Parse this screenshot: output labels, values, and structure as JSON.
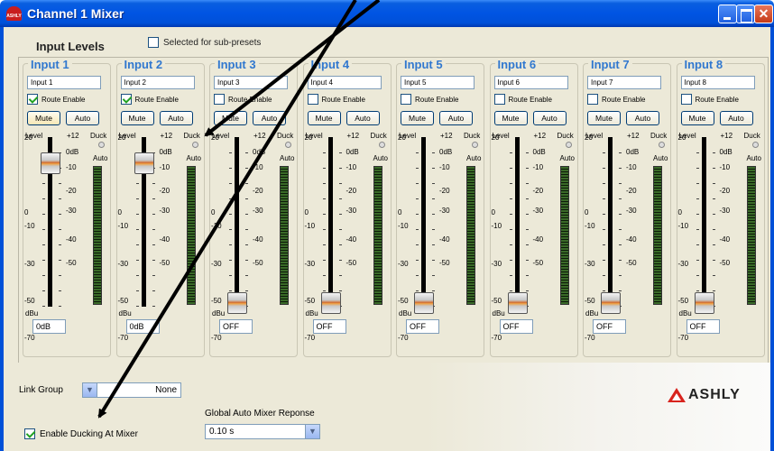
{
  "window": {
    "title": "Channel 1   Mixer",
    "app_icon_text": "ASHLY",
    "buttons": [
      "minimize-icon",
      "maximize-icon",
      "close-icon"
    ]
  },
  "header": {
    "input_levels_label": "Input Levels",
    "selected_sub_presets_label": "Selected for sub-presets",
    "selected_sub_presets_checked": false
  },
  "strip_labels": {
    "route_enable": "Route Enable",
    "mute": "Mute",
    "auto": "Auto",
    "level": "Level",
    "plus12": "+12",
    "duck": "Duck",
    "auto_meter": "Auto",
    "dbu": "dBu",
    "left_scale": [
      "20",
      "0",
      "-10",
      "-30",
      "-50",
      "-70"
    ],
    "right_scale": [
      "0dB",
      "-10",
      "-20",
      "-30",
      "-40",
      "-50"
    ]
  },
  "channels": [
    {
      "title": "Input 1",
      "name": "Input 1",
      "route_enable": true,
      "fader_value": "0dB",
      "fader_level": "0dB",
      "muted_highlight": true
    },
    {
      "title": "Input 2",
      "name": "Input 2",
      "route_enable": true,
      "fader_value": "0dB",
      "fader_level": "0dB",
      "muted_highlight": false
    },
    {
      "title": "Input 3",
      "name": "Input 3",
      "route_enable": false,
      "fader_value": "OFF",
      "fader_level": "OFF",
      "muted_highlight": false
    },
    {
      "title": "Input 4",
      "name": "Input 4",
      "route_enable": false,
      "fader_value": "OFF",
      "fader_level": "OFF",
      "muted_highlight": false
    },
    {
      "title": "Input 5",
      "name": "Input 5",
      "route_enable": false,
      "fader_value": "OFF",
      "fader_level": "OFF",
      "muted_highlight": false
    },
    {
      "title": "Input 6",
      "name": "Input 6",
      "route_enable": false,
      "fader_value": "OFF",
      "fader_level": "OFF",
      "muted_highlight": false
    },
    {
      "title": "Input 7",
      "name": "Input 7",
      "route_enable": false,
      "fader_value": "OFF",
      "fader_level": "OFF",
      "muted_highlight": false
    },
    {
      "title": "Input 8",
      "name": "Input 8",
      "route_enable": false,
      "fader_value": "OFF",
      "fader_level": "OFF",
      "muted_highlight": false
    }
  ],
  "bottom": {
    "link_group_label": "Link Group",
    "link_group_value": "None",
    "enable_ducking_label": "Enable Ducking At Mixer",
    "enable_ducking_checked": true,
    "global_auto_mixer_label": "Global Auto Mixer Reponse",
    "global_auto_mixer_value": "0.10 s"
  },
  "logo": {
    "text": "ASHLY",
    "color": "#d8231d"
  },
  "colors": {
    "title_bar": "#0054e3",
    "channel_title": "#3178cf",
    "client_bg": "#ece9d8",
    "annotation_arrow": "#000000"
  }
}
